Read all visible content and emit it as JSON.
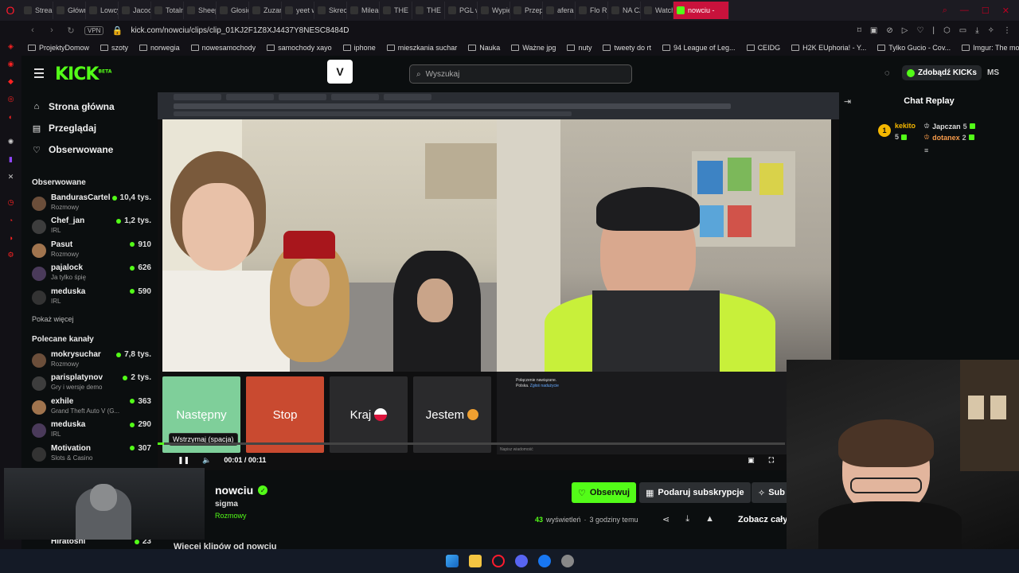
{
  "browser": {
    "tabs": [
      "Stream",
      "Główn",
      "Lowcy",
      "Jacoo",
      "Totaln",
      "Sheep",
      "Głosic",
      "Zuzan",
      "yeet w",
      "Skrec",
      "Mileag",
      "THE",
      "THE",
      "PGL w",
      "Wypie",
      "Przep",
      "afera k",
      "Flo Ri",
      "NA CZ",
      "Watch",
      "nowciu -"
    ],
    "url": "kick.com/nowciu/clips/clip_01KJ2F1Z8XJ4437Y8NESC8484D",
    "vpn_label": "VPN",
    "bookmarks": [
      "ProjektyDomow",
      "szoty",
      "norwegia",
      "nowesamochody",
      "samochody xayo",
      "iphone",
      "mieszkania suchar",
      "Nauka",
      "Ważne jpg",
      "nuty",
      "tweety do rt",
      "94 League of Leg...",
      "CEIDG",
      "H2K EUphoria! - Y...",
      "Tylko Gucio - Cov...",
      "Imgur: The most a..."
    ]
  },
  "header": {
    "logo": "KICK",
    "logo_beta": "BETA",
    "v_button": "V",
    "search_placeholder": "Wyszukaj",
    "kicks_button": "Zdobądź KICKs",
    "user_initials": "MS"
  },
  "sidebar": {
    "nav": [
      {
        "label": "Strona główna",
        "icon": "home-icon"
      },
      {
        "label": "Przeglądaj",
        "icon": "browse-icon"
      },
      {
        "label": "Obserwowane",
        "icon": "heart-icon"
      }
    ],
    "followed_title": "Obserwowane",
    "followed": [
      {
        "name": "BandurasCartel",
        "category": "Rozmowy",
        "viewers": "10,4 tys."
      },
      {
        "name": "Chef_jan",
        "category": "IRL",
        "viewers": "1,2 tys."
      },
      {
        "name": "Pasut",
        "category": "Rozmowy",
        "viewers": "910"
      },
      {
        "name": "pajalock",
        "category": "Ja tylko śpię",
        "viewers": "626"
      },
      {
        "name": "meduska",
        "category": "IRL",
        "viewers": "590"
      }
    ],
    "show_more": "Pokaż więcej",
    "recommended_title": "Polecane kanały",
    "recommended": [
      {
        "name": "mokrysuchar",
        "category": "Rozmowy",
        "viewers": "7,8 tys."
      },
      {
        "name": "parisplatynov",
        "category": "Gry i wersje demo",
        "viewers": "2 tys."
      },
      {
        "name": "exhile",
        "category": "Grand Theft Auto V (G...",
        "viewers": "363"
      },
      {
        "name": "meduska",
        "category": "IRL",
        "viewers": "290"
      },
      {
        "name": "Motivation",
        "category": "Slots & Casino",
        "viewers": "307"
      }
    ],
    "bottom_channel": {
      "name": "Hiratoshi",
      "viewers": "23"
    }
  },
  "video": {
    "buttons": [
      "Następny",
      "Stop",
      "Kraj",
      "Jestem"
    ],
    "tooltip": "Wstrzymaj (spacja)",
    "time": "00:01 / 00:11",
    "progress_fraction": 0.01,
    "omegle_status": "Połączenie nawiązane.",
    "omegle_country": "Polska",
    "omegle_report": "Zgłoś nadużycie",
    "omegle_input_placeholder": "Napisz wiadomość"
  },
  "chat": {
    "title": "Chat Replay",
    "gifter": {
      "name": "kekito",
      "count": "5",
      "rank": "1"
    },
    "recipients": [
      {
        "name": "Japczan",
        "count": "5"
      },
      {
        "name": "dotanex",
        "count": "2"
      }
    ]
  },
  "clip": {
    "streamer": "nowciu",
    "title": "sigma",
    "category": "Rozmowy",
    "follow": "Obserwuj",
    "subscribe_gift": "Podaruj subskrypcje",
    "subscribe": "Sub",
    "views": "43",
    "views_label": "wyświetleń",
    "time_ago": "3 godziny temu",
    "see_all": "Zobacz cały",
    "more_clips": "Więcej klipów od nowciu"
  },
  "colors": {
    "kick_green": "#53fc18",
    "stop_red": "#c94a30",
    "next_green": "#7fcf9a",
    "opera_red": "#ff1b2d"
  }
}
